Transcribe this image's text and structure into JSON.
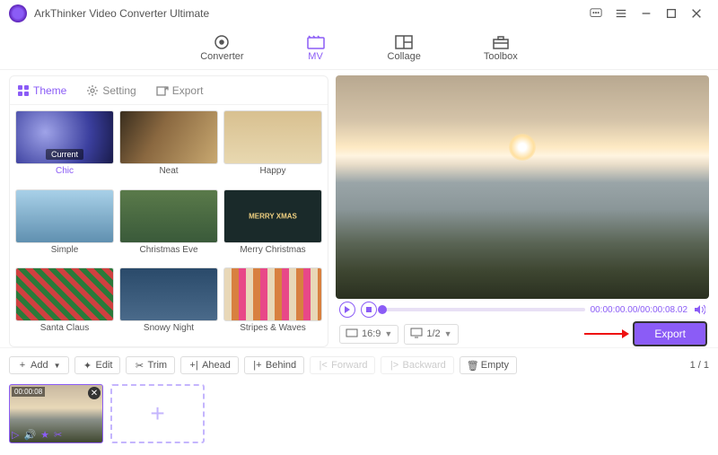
{
  "app": {
    "title": "ArkThinker Video Converter Ultimate"
  },
  "nav": {
    "converter": "Converter",
    "mv": "MV",
    "collage": "Collage",
    "toolbox": "Toolbox"
  },
  "tabs": {
    "theme": "Theme",
    "setting": "Setting",
    "export": "Export"
  },
  "themes": {
    "current_overlay": "Current",
    "items": [
      {
        "label": "Chic",
        "cls": "th-chic",
        "active": true
      },
      {
        "label": "Neat",
        "cls": "th-neat"
      },
      {
        "label": "Happy",
        "cls": "th-happy"
      },
      {
        "label": "Simple",
        "cls": "th-simple"
      },
      {
        "label": "Christmas Eve",
        "cls": "th-xmaseve"
      },
      {
        "label": "Merry Christmas",
        "cls": "th-merry"
      },
      {
        "label": "Santa Claus",
        "cls": "th-santa"
      },
      {
        "label": "Snowy Night",
        "cls": "th-snowy"
      },
      {
        "label": "Stripes & Waves",
        "cls": "th-stripes"
      }
    ]
  },
  "player": {
    "time_current": "00:00:00.00",
    "time_total": "00:00:08.02",
    "ratio": "16:9",
    "fraction": "1/2",
    "export": "Export"
  },
  "toolbar": {
    "add": "Add",
    "edit": "Edit",
    "trim": "Trim",
    "ahead": "Ahead",
    "behind": "Behind",
    "forward": "Forward",
    "backward": "Backward",
    "empty": "Empty",
    "page_current": 1,
    "page_total": 1,
    "page_sep": " / "
  },
  "clip": {
    "timestamp": "00:00:08"
  },
  "colors": {
    "accent": "#8b5cf6"
  }
}
